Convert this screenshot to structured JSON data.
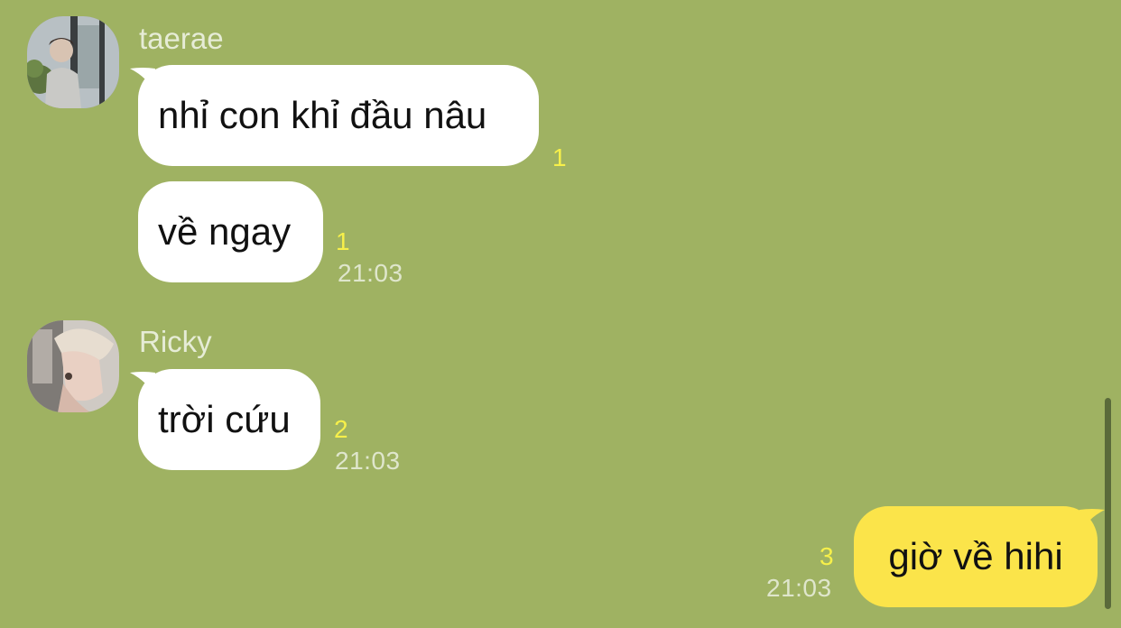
{
  "messages": [
    {
      "sender": "taerae",
      "avatar": "avatar-taerae",
      "bubbles": [
        {
          "text": "nhỉ con khỉ đầu nâu",
          "unread": "1"
        },
        {
          "text": "về ngay",
          "unread": "1",
          "time": "21:03"
        }
      ]
    },
    {
      "sender": "Ricky",
      "avatar": "avatar-ricky",
      "bubbles": [
        {
          "text": "trời cứu",
          "unread": "2",
          "time": "21:03"
        }
      ]
    },
    {
      "sender": "me",
      "bubbles": [
        {
          "text": "giờ về hihi",
          "unread": "3",
          "time": "21:03"
        }
      ]
    }
  ],
  "colors": {
    "background": "#9fb262",
    "incoming_bubble": "#ffffff",
    "outgoing_bubble": "#fbe44a",
    "unread_count": "#f7f04a",
    "timestamp": "#dfe6cc"
  }
}
